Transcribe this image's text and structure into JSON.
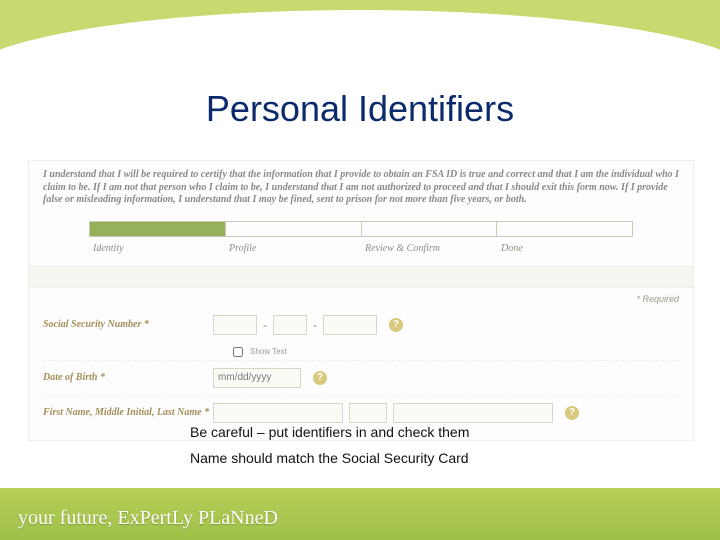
{
  "title": "Personal Identifiers",
  "disclaimer": "I understand that I will be required to certify that the information that I provide to obtain an FSA ID is true and correct and that I am the individual who I claim to be. If I am not that person who I claim to be, I understand that I am not authorized to proceed and that I should exit this form now. If I provide false or misleading information, I understand that I may be fined, sent to prison for not more than five years, or both.",
  "stepper": {
    "steps": [
      "Identity",
      "Profile",
      "Review & Confirm",
      "Done"
    ],
    "active_index": 0
  },
  "required_label": "* Required",
  "rows": {
    "ssn": {
      "label": "Social Security Number *",
      "sep": "-",
      "help": "?",
      "show_text": "Show Text"
    },
    "dob": {
      "label": "Date of Birth *",
      "placeholder": "mm/dd/yyyy",
      "help": "?"
    },
    "name": {
      "label": "First Name, Middle Initial, Last Name *",
      "help": "?"
    }
  },
  "notes": {
    "line1": "Be careful – put identifiers in and check them",
    "line2": "Name should match the Social Security Card"
  },
  "footer": {
    "brand": "your future, ExPertLy PLaNneD"
  }
}
